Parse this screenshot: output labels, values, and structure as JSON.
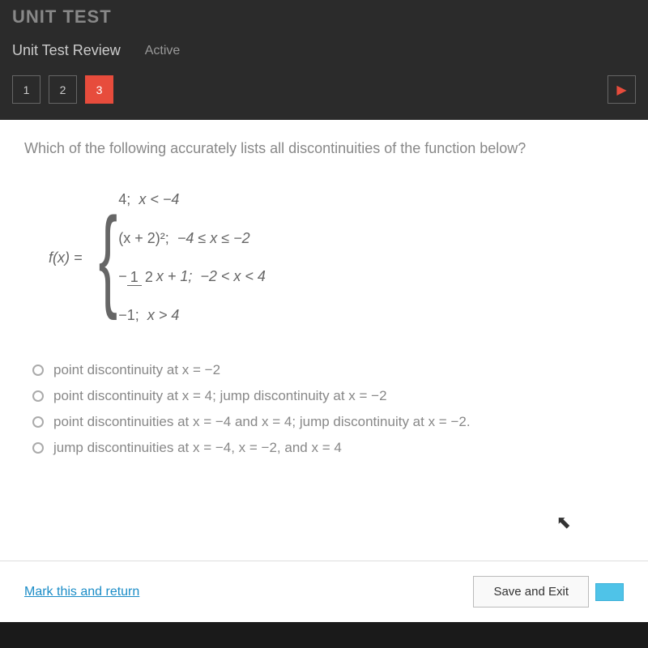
{
  "header": {
    "title": "Unit Test"
  },
  "subheader": {
    "review": "Unit Test Review",
    "active": "Active"
  },
  "nav": {
    "items": [
      "1",
      "2",
      "3"
    ],
    "activeIndex": 2,
    "arrow": "▶"
  },
  "question": {
    "prompt": "Which of the following accurately lists all discontinuities of the function below?",
    "fx": "f(x) =",
    "pieces": {
      "p1_val": "4;",
      "p1_cond": "x < −4",
      "p2_val": "(x + 2)²;",
      "p2_cond": "−4 ≤ x ≤ −2",
      "p3_neg": "−",
      "p3_num": "1",
      "p3_den": "2",
      "p3_rest": "x + 1;",
      "p3_cond": "−2 < x < 4",
      "p4_val": "−1;",
      "p4_cond": "x > 4"
    }
  },
  "options": [
    "point discontinuity at x = −2",
    "point discontinuity at x = 4; jump discontinuity at x = −2",
    "point discontinuities at x = −4 and x = 4; jump discontinuity at x = −2.",
    "jump discontinuities at x = −4, x = −2, and x = 4"
  ],
  "footer": {
    "mark": "Mark this and return",
    "save": "Save and Exit"
  },
  "cursor": "↖"
}
